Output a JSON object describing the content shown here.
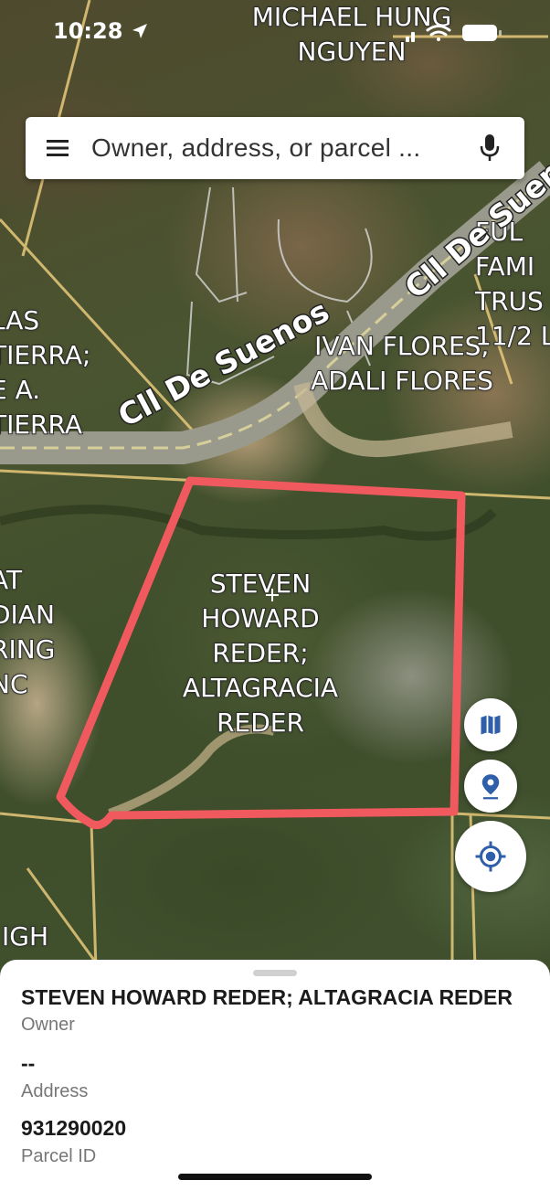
{
  "status_bar": {
    "time": "10:28"
  },
  "search": {
    "placeholder": "Owner, address, or parcel ..."
  },
  "map": {
    "owner_labels": [
      "MICHAEL HUNG NGUYEN",
      "LAS TIERRA; E A. TIERRA",
      "IVAN FLORES; ADALI FLORES",
      "FUL FAMI TRUS 11/2 L",
      "STEVEN HOWARD REDER; ALTAGRACIA REDER",
      "AT DIAN RING NC",
      "IGH"
    ],
    "road_labels": [
      "Cll De Suenos",
      "Cll De Suenos"
    ],
    "parcel_outline_color": "#f05a5e"
  },
  "parcel": {
    "owner": "STEVEN HOWARD REDER; ALTAGRACIA REDER",
    "owner_label": "Owner",
    "address": "--",
    "address_label": "Address",
    "parcel_id": "931290020",
    "parcel_id_label": "Parcel ID"
  },
  "accent_color": "#2f5fa8"
}
